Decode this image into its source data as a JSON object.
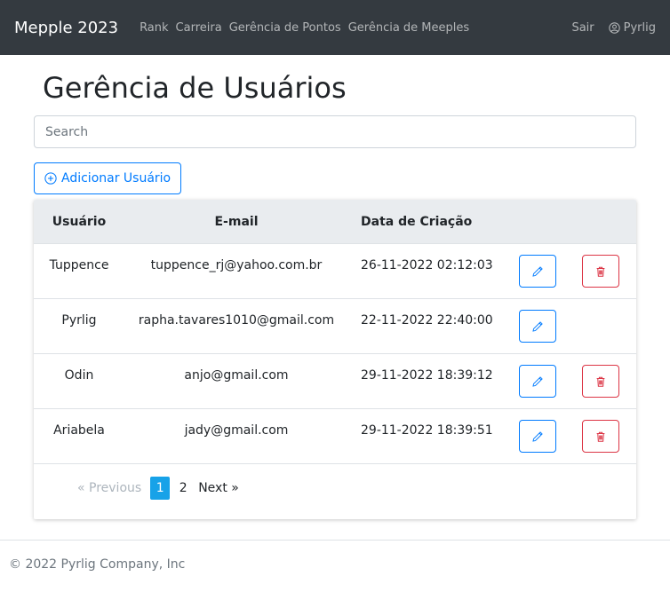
{
  "navbar": {
    "brand": "Mepple 2023",
    "links": [
      "Rank",
      "Carreira",
      "Gerência de Pontos",
      "Gerência de Meeples"
    ],
    "logout": "Sair",
    "user": "Pyrlig"
  },
  "page": {
    "title": "Gerência de Usuários",
    "search_placeholder": "Search",
    "add_button": "Adicionar Usuário"
  },
  "table": {
    "headers": {
      "user": "Usuário",
      "email": "E-mail",
      "date": "Data de Criação"
    },
    "rows": [
      {
        "user": "Tuppence",
        "email": "tuppence_rj@yahoo.com.br",
        "date": "26-11-2022 02:12:03",
        "can_delete": true
      },
      {
        "user": "Pyrlig",
        "email": "rapha.tavares1010@gmail.com",
        "date": "22-11-2022 22:40:00",
        "can_delete": false
      },
      {
        "user": "Odin",
        "email": "anjo@gmail.com",
        "date": "29-11-2022 18:39:12",
        "can_delete": true
      },
      {
        "user": "Ariabela",
        "email": "jady@gmail.com",
        "date": "29-11-2022 18:39:51",
        "can_delete": true
      }
    ]
  },
  "pagination": {
    "previous": "« Previous",
    "pages": [
      "1",
      "2"
    ],
    "active": "1",
    "next": "Next »"
  },
  "footer": "© 2022 Pyrlig Company, Inc",
  "colors": {
    "navbar": "#343a40",
    "primary": "#007bff",
    "danger": "#dc3545",
    "active_page": "#17a2e8"
  },
  "icons": {
    "add": "plus-circle-icon",
    "edit": "pencil-icon",
    "delete": "trash-icon",
    "user": "user-circle-icon"
  }
}
